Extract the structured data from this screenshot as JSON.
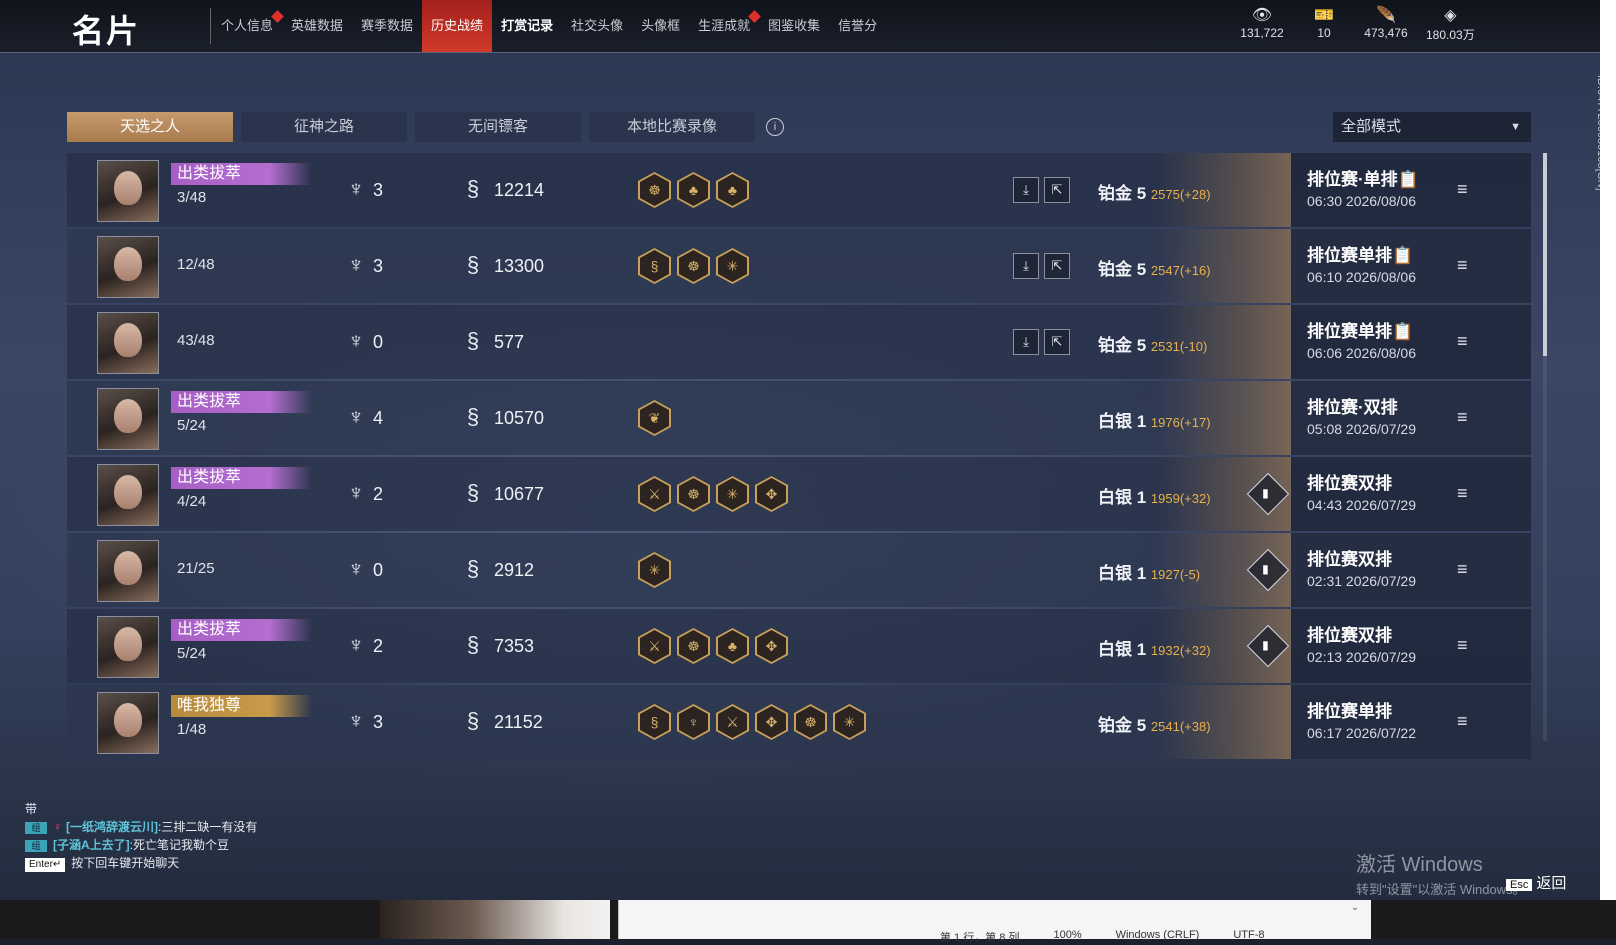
{
  "header": {
    "title": "名片",
    "tabs": [
      {
        "label": "个人信息",
        "active": false,
        "bold": false,
        "dot": true
      },
      {
        "label": "英雄数据",
        "active": false,
        "bold": false,
        "dot": false
      },
      {
        "label": "赛季数据",
        "active": false,
        "bold": false,
        "dot": false
      },
      {
        "label": "历史战绩",
        "active": true,
        "bold": false,
        "dot": false
      },
      {
        "label": "打赏记录",
        "active": false,
        "bold": true,
        "dot": false
      },
      {
        "label": "社交头像",
        "active": false,
        "bold": false,
        "dot": false
      },
      {
        "label": "头像框",
        "active": false,
        "bold": false,
        "dot": false
      },
      {
        "label": "生涯成就",
        "active": false,
        "bold": false,
        "dot": true
      },
      {
        "label": "图鉴收集",
        "active": false,
        "bold": false,
        "dot": false
      },
      {
        "label": "信誉分",
        "active": false,
        "bold": false,
        "dot": false
      }
    ],
    "currencies": [
      {
        "icon": "eye-coin-icon",
        "glyph": "👁",
        "value": "131,722"
      },
      {
        "icon": "ticket-icon",
        "glyph": "🎫",
        "value": "10"
      },
      {
        "icon": "feather-icon",
        "glyph": "🪶",
        "value": "473,476"
      },
      {
        "icon": "gem-icon",
        "glyph": "◈",
        "value": "180.03万"
      }
    ]
  },
  "filters": {
    "tabs": [
      {
        "label": "天选之人",
        "active": true
      },
      {
        "label": "征神之路",
        "active": false
      },
      {
        "label": "无间镖客",
        "active": false
      },
      {
        "label": "本地比赛录像",
        "active": false
      }
    ],
    "info_glyph": "i",
    "mode_select": "全部模式",
    "caret": "▼"
  },
  "matches": [
    {
      "badge": "出类拔萃",
      "badge_style": "purple",
      "rank": "3/48",
      "kills": "3",
      "damage": "12214",
      "achievements": [
        "☸",
        "♣",
        "♣"
      ],
      "replay": true,
      "tier": "铂金 5",
      "points": "2575(+28)",
      "stats": false,
      "mode": "排位赛·单排",
      "mode_icon": "📋",
      "time": "06:30 2026/08/06"
    },
    {
      "badge": "",
      "badge_style": "",
      "rank": "12/48",
      "kills": "3",
      "damage": "13300",
      "achievements": [
        "§",
        "☸",
        "✳"
      ],
      "replay": true,
      "tier": "铂金 5",
      "points": "2547(+16)",
      "stats": false,
      "mode": "排位赛单排",
      "mode_icon": "📋",
      "time": "06:10 2026/08/06"
    },
    {
      "badge": "",
      "badge_style": "",
      "rank": "43/48",
      "kills": "0",
      "damage": "577",
      "achievements": [],
      "replay": true,
      "tier": "铂金 5",
      "points": "2531(-10)",
      "stats": false,
      "mode": "排位赛单排",
      "mode_icon": "📋",
      "time": "06:06 2026/08/06"
    },
    {
      "badge": "出类拔萃",
      "badge_style": "purple",
      "rank": "5/24",
      "kills": "4",
      "damage": "10570",
      "achievements": [
        "❦"
      ],
      "replay": false,
      "tier": "白银 1",
      "points": "1976(+17)",
      "stats": false,
      "mode": "排位赛·双排",
      "mode_icon": "",
      "time": "05:08 2026/07/29"
    },
    {
      "badge": "出类拔萃",
      "badge_style": "purple",
      "rank": "4/24",
      "kills": "2",
      "damage": "10677",
      "achievements": [
        "⚔",
        "☸",
        "✳",
        "✥"
      ],
      "replay": false,
      "tier": "白银 1",
      "points": "1959(+32)",
      "stats": true,
      "mode": "排位赛双排",
      "mode_icon": "",
      "time": "04:43 2026/07/29"
    },
    {
      "badge": "",
      "badge_style": "",
      "rank": "21/25",
      "kills": "0",
      "damage": "2912",
      "achievements": [
        "✳"
      ],
      "replay": false,
      "tier": "白银 1",
      "points": "1927(-5)",
      "stats": true,
      "mode": "排位赛双排",
      "mode_icon": "",
      "time": "02:31 2026/07/29"
    },
    {
      "badge": "出类拔萃",
      "badge_style": "purple",
      "rank": "5/24",
      "kills": "2",
      "damage": "7353",
      "achievements": [
        "⚔",
        "☸",
        "♣",
        "✥"
      ],
      "replay": false,
      "tier": "白银 1",
      "points": "1932(+32)",
      "stats": true,
      "mode": "排位赛双排",
      "mode_icon": "",
      "time": "02:13 2026/07/29"
    },
    {
      "badge": "唯我独尊",
      "badge_style": "gold",
      "rank": "1/48",
      "kills": "3",
      "damage": "21152",
      "achievements": [
        "§",
        "♆",
        "⚔",
        "✥",
        "☸",
        "✳"
      ],
      "replay": false,
      "tier": "铂金 5",
      "points": "2541(+38)",
      "stats": false,
      "mode": "排位赛单排",
      "mode_icon": "",
      "time": "06:17 2026/07/22"
    }
  ],
  "icons": {
    "kills": "♆",
    "damage": "§",
    "download": "⤓",
    "share": "⇱",
    "menu": "≡",
    "stats": "▮"
  },
  "side_id": "ID:6477200080163[CN]",
  "chat": {
    "line0": "带",
    "messages": [
      {
        "tag": "组",
        "female": "♀",
        "name": "[一纸鸿辞渡云川]",
        "text": ":三排二缺一有没有"
      },
      {
        "tag": "组",
        "female": "",
        "name": "[子涵A上去了]",
        "text": ":死亡笔记我勒个豆"
      }
    ],
    "enter_key": "Enter↵",
    "hint": "按下回车键开始聊天"
  },
  "activate": {
    "title": "激活 Windows",
    "sub": "转到\"设置\"以激活 Windows。"
  },
  "esc": {
    "key": "Esc",
    "label": "返回"
  },
  "editor_status": [
    "第 1 行，第 8 列",
    "100%",
    "Windows (CRLF)",
    "UTF-8"
  ],
  "editor_scroll": "⌄"
}
